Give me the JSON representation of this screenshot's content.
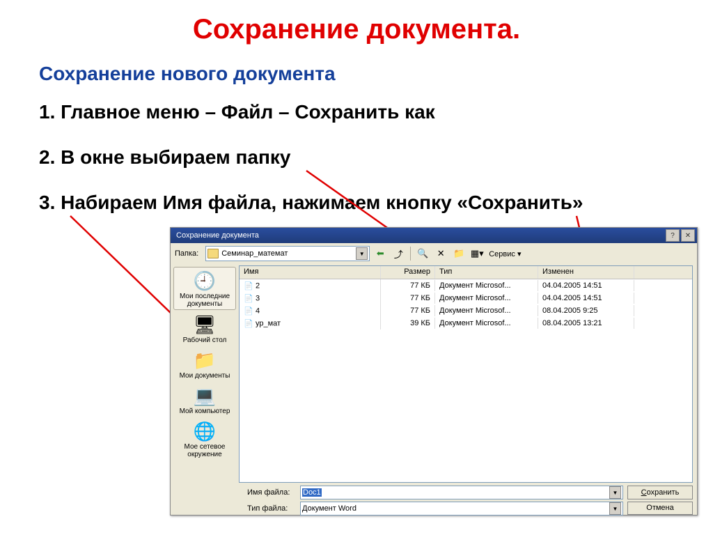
{
  "slide": {
    "title": "Сохранение документа.",
    "subtitle": "Сохранение нового документа",
    "step1": "1. Главное меню – Файл – Сохранить как",
    "step2": "2. В окне выбираем папку",
    "step3": "3. Набираем Имя файла, нажимаем кнопку «Сохранить»"
  },
  "dialog": {
    "title": "Сохранение документа",
    "folder_label": "Папка:",
    "folder_value": "Семинар_математ",
    "tools_label": "Сервис",
    "places": [
      {
        "label": "Мои последние документы",
        "icon": "🕘"
      },
      {
        "label": "Рабочий стол",
        "icon": "🖥"
      },
      {
        "label": "Мои документы",
        "icon": "📁"
      },
      {
        "label": "Мой компьютер",
        "icon": "💻"
      },
      {
        "label": "Мое сетевое окружение",
        "icon": "🌐"
      }
    ],
    "columns": {
      "name": "Имя",
      "size": "Размер",
      "type": "Тип",
      "date": "Изменен"
    },
    "files": [
      {
        "name": "2",
        "size": "77 КБ",
        "type": "Документ Microsof...",
        "date": "04.04.2005 14:51"
      },
      {
        "name": "3",
        "size": "77 КБ",
        "type": "Документ Microsof...",
        "date": "04.04.2005 14:51"
      },
      {
        "name": "4",
        "size": "77 КБ",
        "type": "Документ Microsof...",
        "date": "08.04.2005 9:25"
      },
      {
        "name": "ур_мат",
        "size": "39 КБ",
        "type": "Документ Microsof...",
        "date": "08.04.2005 13:21"
      }
    ],
    "filename_label": "Имя файла:",
    "filename_value": "Doc1",
    "filetype_label": "Тип файла:",
    "filetype_value": "Документ Word",
    "save_btn": "Сохранить",
    "cancel_btn": "Отмена"
  }
}
